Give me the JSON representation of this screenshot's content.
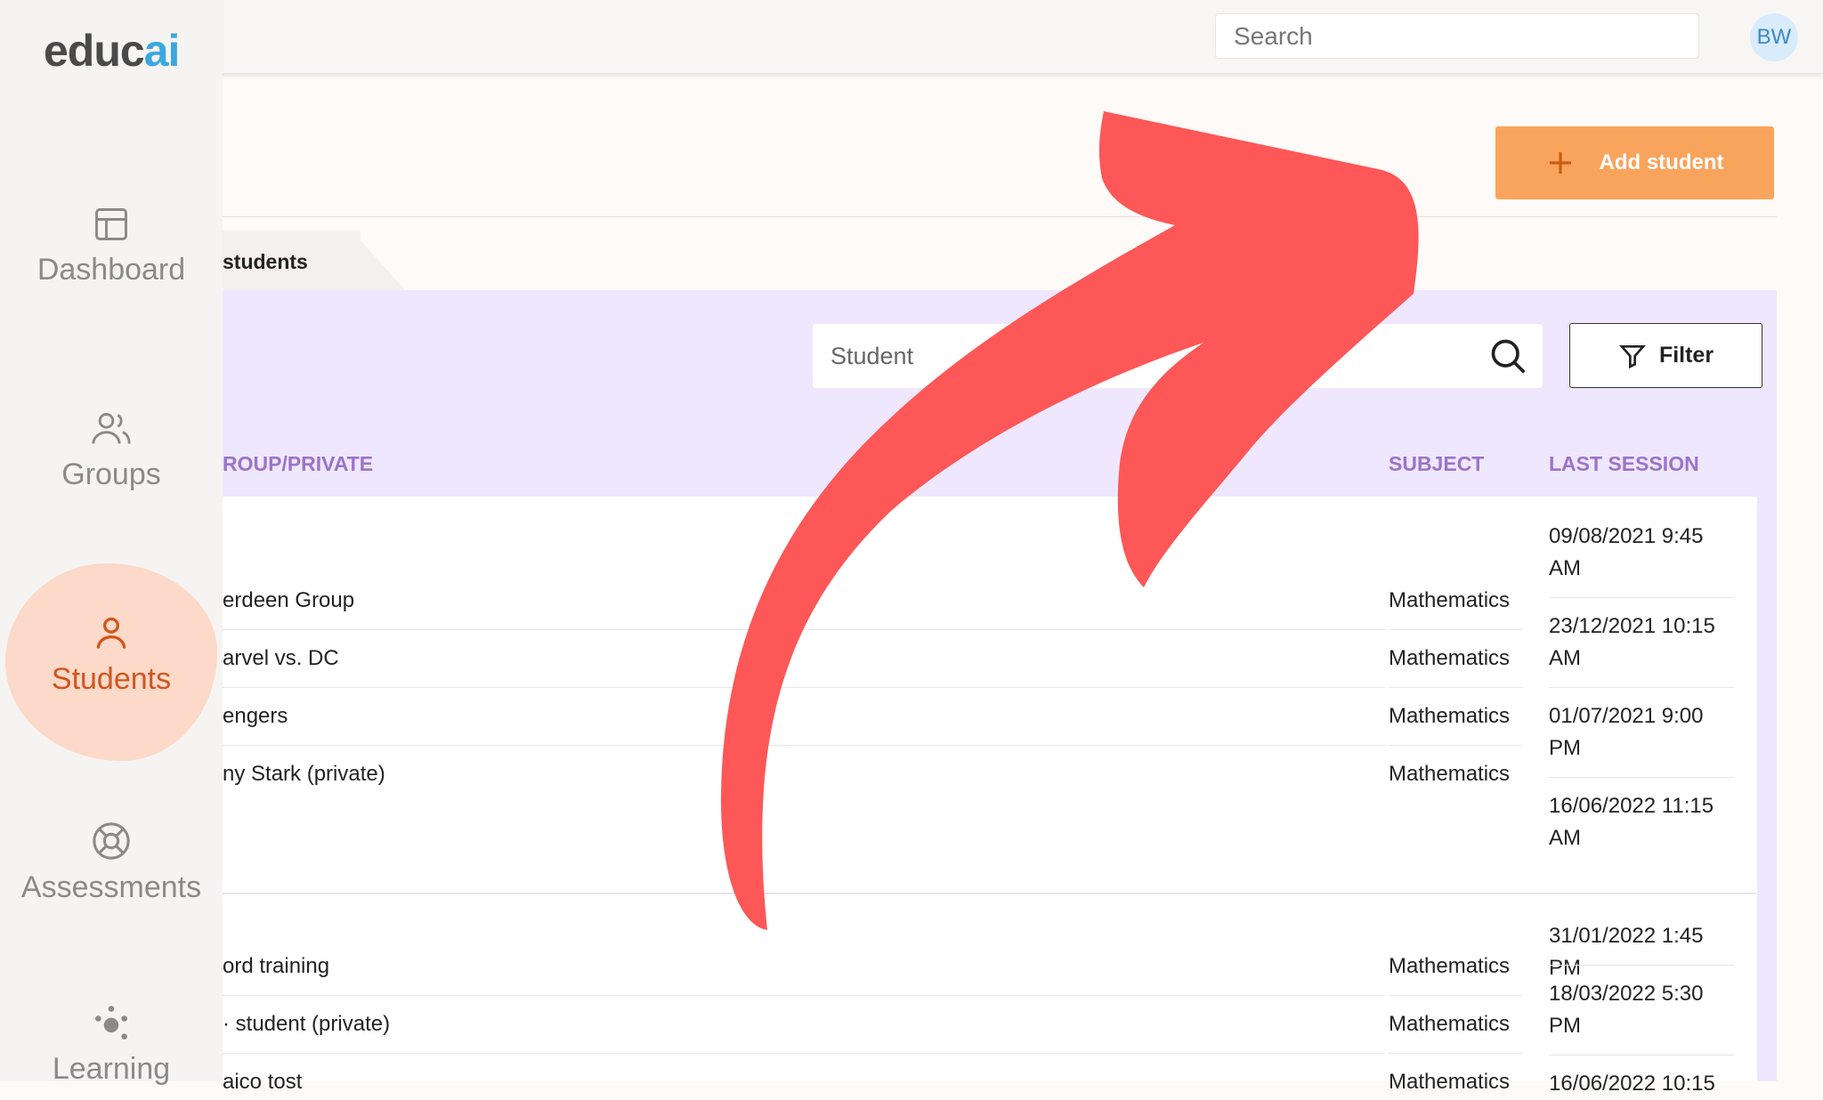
{
  "logo": {
    "text_main": "educ",
    "text_accent": "ai"
  },
  "topbar": {
    "search_placeholder": "Search",
    "avatar_initials": "BW"
  },
  "sidebar": {
    "items": [
      {
        "label": "Dashboard",
        "icon": "dashboard-icon"
      },
      {
        "label": "Groups",
        "icon": "groups-icon"
      },
      {
        "label": "Students",
        "icon": "student-icon",
        "active": true
      },
      {
        "label": "Assessments",
        "icon": "lifebuoy-icon"
      },
      {
        "label": "Learning",
        "icon": "learning-icon"
      }
    ]
  },
  "header": {
    "add_student_label": "Add student"
  },
  "tab": {
    "label": "students"
  },
  "filters": {
    "search_placeholder": "Student",
    "filter_label": "Filter"
  },
  "table": {
    "columns": {
      "group": "ROUP/PRIVATE",
      "subject": "SUBJECT",
      "last_session": "LAST SESSION"
    },
    "card1": {
      "rows": [
        {
          "group": "erdeen Group",
          "subject": "Mathematics"
        },
        {
          "group": "arvel vs. DC",
          "subject": "Mathematics"
        },
        {
          "group": "engers",
          "subject": "Mathematics"
        },
        {
          "group": "ny Stark (private)",
          "subject": "Mathematics"
        }
      ],
      "sessions": [
        "09/08/2021 9:45 AM",
        "23/12/2021 10:15 AM",
        "01/07/2021 9:00 PM",
        "16/06/2022 11:15 AM"
      ]
    },
    "card2": {
      "rows": [
        {
          "group": "ord training",
          "subject": "Mathematics"
        },
        {
          "group": "· student (private)",
          "subject": "Mathematics"
        },
        {
          "group": "aico tost",
          "subject": "Mathematics"
        }
      ],
      "sessions": [
        "31/01/2022 1:45 PM",
        "18/03/2022 5:30 PM",
        "16/06/2022 10:15"
      ]
    }
  },
  "colors": {
    "accent_orange": "#f9a45c",
    "active_nav": "#d1551f",
    "panel_purple": "#efe7fd",
    "header_purple": "#9a74c9",
    "arrow_red": "#fe5757"
  }
}
